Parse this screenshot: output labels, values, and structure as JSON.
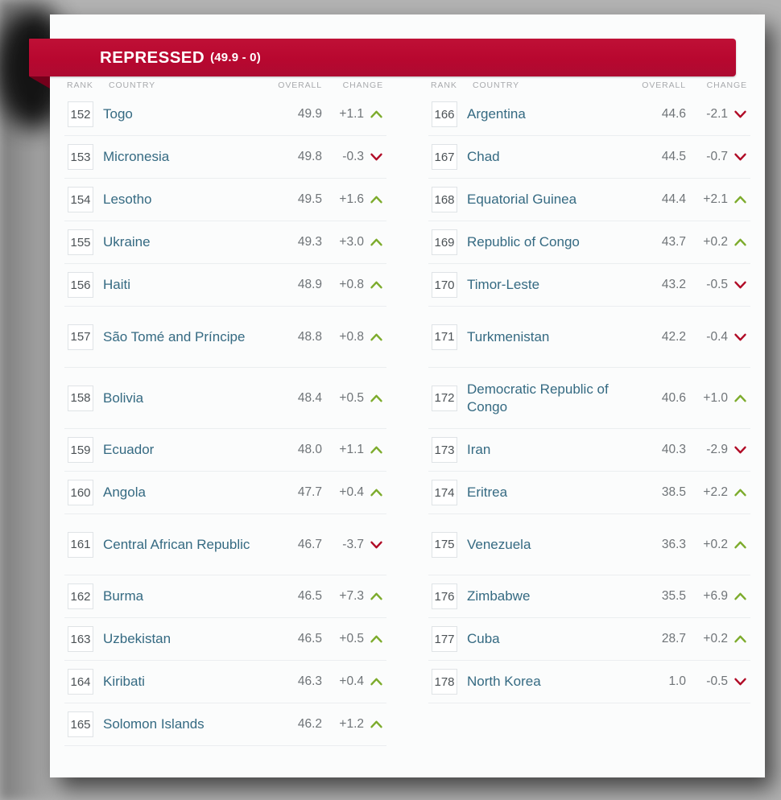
{
  "banner": {
    "title": "REPRESSED",
    "range": "(49.9 - 0)",
    "color": "#b8072f"
  },
  "headers": {
    "rank": "RANK",
    "country": "COUNTRY",
    "overall": "OVERALL",
    "change": "CHANGE"
  },
  "icons": {
    "up": "chevron-up-icon",
    "down": "chevron-down-icon",
    "up_color": "#7cab2b",
    "down_color": "#b00a25"
  },
  "columns": [
    {
      "rows": [
        {
          "rank": "152",
          "country": "Togo",
          "overall": "49.9",
          "change": "+1.1",
          "dir": "up"
        },
        {
          "rank": "153",
          "country": "Micronesia",
          "overall": "49.8",
          "change": "-0.3",
          "dir": "down"
        },
        {
          "rank": "154",
          "country": "Lesotho",
          "overall": "49.5",
          "change": "+1.6",
          "dir": "up"
        },
        {
          "rank": "155",
          "country": "Ukraine",
          "overall": "49.3",
          "change": "+3.0",
          "dir": "up"
        },
        {
          "rank": "156",
          "country": "Haiti",
          "overall": "48.9",
          "change": "+0.8",
          "dir": "up"
        },
        {
          "rank": "157",
          "country": "São Tomé and Príncipe",
          "overall": "48.8",
          "change": "+0.8",
          "dir": "up",
          "tall": true
        },
        {
          "rank": "158",
          "country": "Bolivia",
          "overall": "48.4",
          "change": "+0.5",
          "dir": "up",
          "tall": true
        },
        {
          "rank": "159",
          "country": "Ecuador",
          "overall": "48.0",
          "change": "+1.1",
          "dir": "up"
        },
        {
          "rank": "160",
          "country": "Angola",
          "overall": "47.7",
          "change": "+0.4",
          "dir": "up"
        },
        {
          "rank": "161",
          "country": "Central African Republic",
          "overall": "46.7",
          "change": "-3.7",
          "dir": "down",
          "tall": true
        },
        {
          "rank": "162",
          "country": "Burma",
          "overall": "46.5",
          "change": "+7.3",
          "dir": "up"
        },
        {
          "rank": "163",
          "country": "Uzbekistan",
          "overall": "46.5",
          "change": "+0.5",
          "dir": "up"
        },
        {
          "rank": "164",
          "country": "Kiribati",
          "overall": "46.3",
          "change": "+0.4",
          "dir": "up"
        },
        {
          "rank": "165",
          "country": "Solomon Islands",
          "overall": "46.2",
          "change": "+1.2",
          "dir": "up"
        }
      ]
    },
    {
      "rows": [
        {
          "rank": "166",
          "country": "Argentina",
          "overall": "44.6",
          "change": "-2.1",
          "dir": "down"
        },
        {
          "rank": "167",
          "country": "Chad",
          "overall": "44.5",
          "change": "-0.7",
          "dir": "down"
        },
        {
          "rank": "168",
          "country": "Equatorial Guinea",
          "overall": "44.4",
          "change": "+2.1",
          "dir": "up"
        },
        {
          "rank": "169",
          "country": "Republic of Congo",
          "overall": "43.7",
          "change": "+0.2",
          "dir": "up"
        },
        {
          "rank": "170",
          "country": "Timor-Leste",
          "overall": "43.2",
          "change": "-0.5",
          "dir": "down"
        },
        {
          "rank": "171",
          "country": "Turkmenistan",
          "overall": "42.2",
          "change": "-0.4",
          "dir": "down",
          "tall": true
        },
        {
          "rank": "172",
          "country": "Democratic Republic of Congo",
          "overall": "40.6",
          "change": "+1.0",
          "dir": "up",
          "tall": true
        },
        {
          "rank": "173",
          "country": "Iran",
          "overall": "40.3",
          "change": "-2.9",
          "dir": "down"
        },
        {
          "rank": "174",
          "country": "Eritrea",
          "overall": "38.5",
          "change": "+2.2",
          "dir": "up"
        },
        {
          "rank": "175",
          "country": "Venezuela",
          "overall": "36.3",
          "change": "+0.2",
          "dir": "up",
          "tall": true
        },
        {
          "rank": "176",
          "country": "Zimbabwe",
          "overall": "35.5",
          "change": "+6.9",
          "dir": "up"
        },
        {
          "rank": "177",
          "country": "Cuba",
          "overall": "28.7",
          "change": "+0.2",
          "dir": "up"
        },
        {
          "rank": "178",
          "country": "North Korea",
          "overall": "1.0",
          "change": "-0.5",
          "dir": "down"
        }
      ]
    }
  ]
}
